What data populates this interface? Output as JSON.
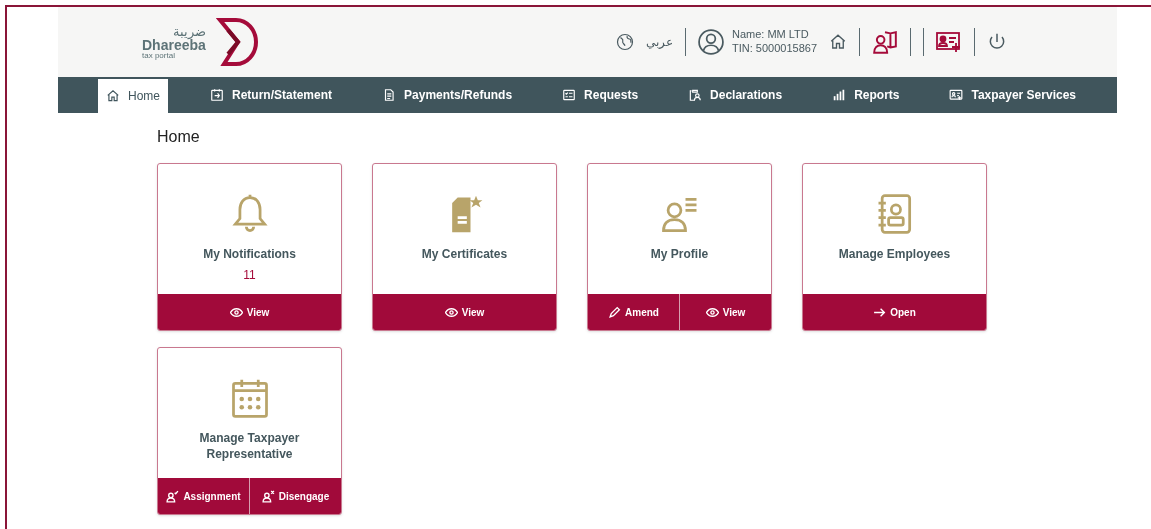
{
  "logo": {
    "arabic": "ضريبة",
    "name": "Dhareeba",
    "tagline": "tax portal"
  },
  "header": {
    "language": "عربي",
    "user_name": "Name: MM LTD",
    "tin": "TIN: 5000015867"
  },
  "nav": [
    {
      "label": "Home",
      "kind": "home",
      "selected": true
    },
    {
      "label": "Return/Statement",
      "kind": "return",
      "selected": false
    },
    {
      "label": "Payments/Refunds",
      "kind": "payments",
      "selected": false
    },
    {
      "label": "Requests",
      "kind": "requests",
      "selected": false
    },
    {
      "label": "Declarations",
      "kind": "declarations",
      "selected": false
    },
    {
      "label": "Reports",
      "kind": "reports",
      "selected": false
    },
    {
      "label": "Taxpayer Services",
      "kind": "services",
      "selected": false
    }
  ],
  "page_title": "Home",
  "cards": [
    {
      "title": "My Notifications",
      "kind": "bell",
      "count": "11",
      "actions": [
        {
          "label": "View",
          "kind": "eye"
        }
      ]
    },
    {
      "title": "My Certificates",
      "kind": "certificate",
      "actions": [
        {
          "label": "View",
          "kind": "eye"
        }
      ]
    },
    {
      "title": "My Profile",
      "kind": "profile",
      "actions": [
        {
          "label": "Amend",
          "kind": "pencil"
        },
        {
          "label": "View",
          "kind": "eye"
        }
      ]
    },
    {
      "title": "Manage Employees",
      "kind": "contacts",
      "actions": [
        {
          "label": "Open",
          "kind": "arrow"
        }
      ]
    },
    {
      "title": "Manage Taxpayer Representative",
      "kind": "calendar",
      "actions": [
        {
          "label": "Assignment",
          "kind": "user-check"
        },
        {
          "label": "Disengage",
          "kind": "user-x"
        }
      ]
    }
  ]
}
